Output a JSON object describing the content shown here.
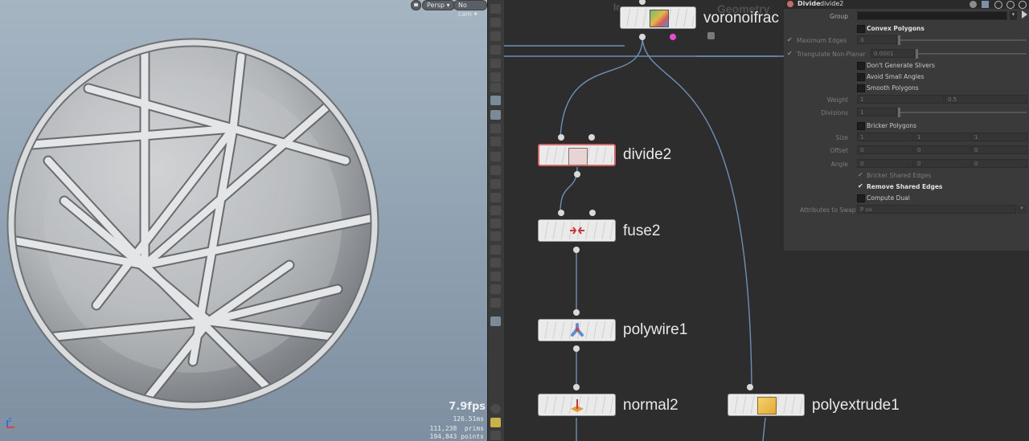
{
  "viewport": {
    "lock_label": "",
    "view_label": "Persp",
    "cam_label": "No cam",
    "fps": "7.9fps",
    "frame_time": "126.51ms",
    "prims_count": "111,238",
    "prims_label": "prims",
    "points_count": "194,843",
    "points_label": "points",
    "axis_label": "Z"
  },
  "network": {
    "context_label": "Geometry",
    "faded_label": "Ir",
    "nodes": {
      "voronoi": "voronoifrac",
      "divide": "divide2",
      "fuse": "fuse2",
      "polywire": "polywire1",
      "normal": "normal2",
      "polyextrude": "polyextrude1"
    }
  },
  "params": {
    "node_type": "Divide",
    "node_name": "divide2",
    "group_label": "Group",
    "group_value": "",
    "convex_polygons": "Convex Polygons",
    "maximum_edges": "Maximum Edges",
    "maximum_edges_value": "3",
    "triangulate_nonplanar": "Triangulate Non-Planar",
    "triangulate_value": "0.0001",
    "dont_generate_slivers": "Don't Generate Slivers",
    "avoid_small_angles": "Avoid Small Angles",
    "smooth_polygons": "Smooth Polygons",
    "weight_label": "Weight",
    "weight_values": [
      "1",
      "0.5"
    ],
    "divisions_label": "Divisions",
    "divisions_value": "1",
    "bricker_polygons": "Bricker Polygons",
    "size_label": "Size",
    "size_values": [
      "1",
      "1",
      "1"
    ],
    "offset_label": "Offset",
    "offset_values": [
      "0",
      "0",
      "0"
    ],
    "angle_label": "Angle",
    "angle_values": [
      "0",
      "0",
      "0"
    ],
    "bricker_shared_edges": "Bricker Shared Edges",
    "remove_shared_edges": "Remove Shared Edges",
    "compute_dual": "Compute Dual",
    "attributes_to_swap": "Attributes to Swap",
    "attributes_value": "P uv"
  },
  "colors": {
    "viewport_bg_top": "#a6b5c2",
    "network_bg": "#2d2d2d",
    "wire": "#6f8fb5",
    "selected_outline": "#c86a6a",
    "flag_pink": "#e64bd2"
  }
}
